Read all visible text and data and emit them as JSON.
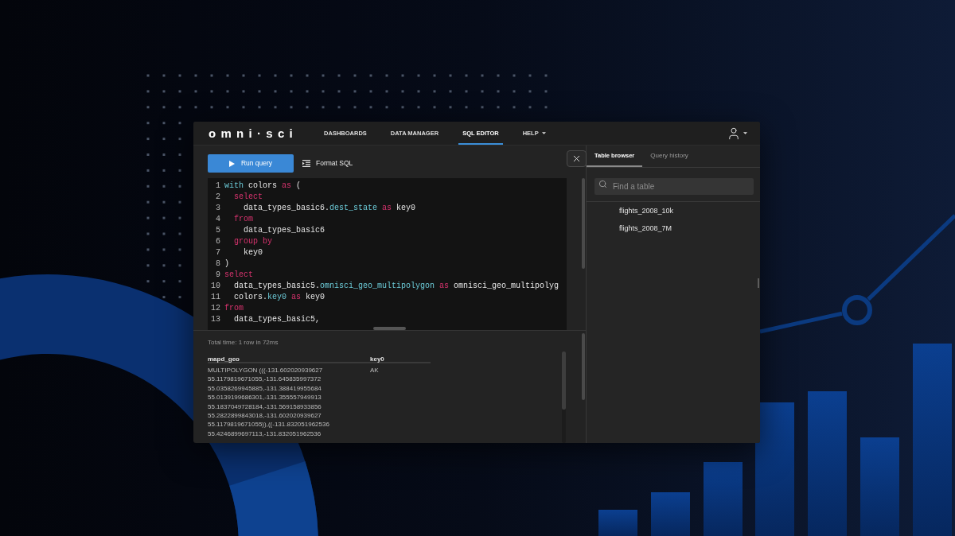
{
  "header": {
    "logo": "omni·sci",
    "nav": [
      {
        "label": "DASHBOARDS",
        "kind": "link",
        "selected": false
      },
      {
        "label": "DATA MANAGER",
        "kind": "link",
        "selected": false
      },
      {
        "label": "SQL EDITOR",
        "kind": "link",
        "selected": true
      },
      {
        "label": "HELP",
        "kind": "menu",
        "selected": false
      }
    ]
  },
  "toolbar": {
    "run_button": "Run query",
    "format_button": "Format SQL"
  },
  "editor": {
    "lines": [
      {
        "number": "1",
        "tokens": [
          {
            "text": "with",
            "kind": "accent"
          },
          {
            "text": " colors ",
            "kind": "plain"
          },
          {
            "text": "as",
            "kind": "keyword"
          },
          {
            "text": " (",
            "kind": "plain"
          }
        ]
      },
      {
        "number": "2",
        "tokens": [
          {
            "text": "  select",
            "kind": "keyword"
          }
        ]
      },
      {
        "number": "3",
        "tokens": [
          {
            "text": "    data_types_basic6.",
            "kind": "plain"
          },
          {
            "text": "dest_state",
            "kind": "accent"
          },
          {
            "text": " as",
            "kind": "keyword"
          },
          {
            "text": " key0",
            "kind": "plain"
          }
        ]
      },
      {
        "number": "4",
        "tokens": [
          {
            "text": "  from",
            "kind": "keyword"
          }
        ]
      },
      {
        "number": "5",
        "tokens": [
          {
            "text": "    data_types_basic6",
            "kind": "plain"
          }
        ]
      },
      {
        "number": "6",
        "tokens": [
          {
            "text": "  group by",
            "kind": "keyword"
          }
        ]
      },
      {
        "number": "7",
        "tokens": [
          {
            "text": "    key0",
            "kind": "plain"
          }
        ]
      },
      {
        "number": "8",
        "tokens": [
          {
            "text": ")",
            "kind": "plain"
          }
        ]
      },
      {
        "number": "9",
        "tokens": [
          {
            "text": "select",
            "kind": "keyword"
          }
        ]
      },
      {
        "number": "10",
        "tokens": [
          {
            "text": "  data_types_basic5.",
            "kind": "plain"
          },
          {
            "text": "omnisci_geo_multipolygon",
            "kind": "accent"
          },
          {
            "text": " as",
            "kind": "keyword"
          },
          {
            "text": " omnisci_geo_multipolyg",
            "kind": "plain"
          }
        ]
      },
      {
        "number": "11",
        "tokens": [
          {
            "text": "  colors.",
            "kind": "plain"
          },
          {
            "text": "key0",
            "kind": "accent"
          },
          {
            "text": " as",
            "kind": "keyword"
          },
          {
            "text": " key0",
            "kind": "plain"
          }
        ]
      },
      {
        "number": "12",
        "tokens": [
          {
            "text": "from",
            "kind": "keyword"
          }
        ]
      },
      {
        "number": "13",
        "tokens": [
          {
            "text": "  data_types_basic5,",
            "kind": "plain"
          }
        ]
      }
    ]
  },
  "results": {
    "status": "Total time: 1 row in 72ms",
    "columns": [
      "mapd_geo",
      "key0"
    ],
    "rows": [
      [
        "MULTIPOLYGON (((-131.602020939627 55.1179819671055,-131.645835997372 55.0358269945885,-131.388419955684 55.0139199686301,-131.355557949913 55.1837049728184,-131.569158933856 55.2822899843018,-131.602020939627 55.1179819671055)),((-131.832051962536 55.4246899697113,-131.832051962536",
        "AK"
      ]
    ]
  },
  "side_panel": {
    "tabs": [
      {
        "label": "Table browser",
        "selected": true
      },
      {
        "label": "Query history",
        "selected": false
      }
    ],
    "search": {
      "placeholder": "Find a table"
    },
    "tables": [
      "flights_2008_10k",
      "flights_2008_7M"
    ]
  }
}
